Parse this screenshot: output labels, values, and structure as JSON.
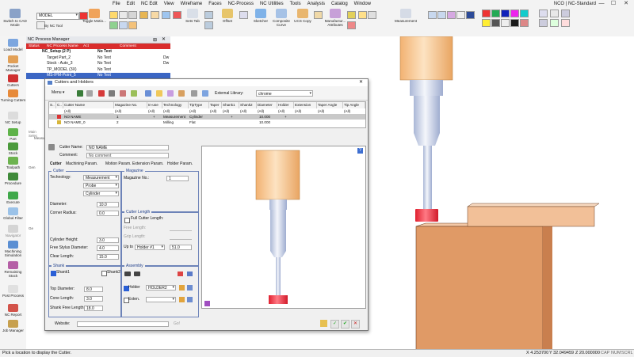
{
  "window": {
    "title": "NCO | NC-Standard",
    "minimize": "—",
    "maximize": "☐",
    "close": "✕"
  },
  "menu": [
    "File",
    "Edit",
    "NC Edit",
    "View",
    "Wireframe",
    "Faces",
    "NC-Process",
    "NC Utilities",
    "Tools",
    "Analysis",
    "Catalog",
    "Window"
  ],
  "ribbon": {
    "switch_cad": "Switch to CAD Mode",
    "model_select": "MODEL",
    "by_nc_tool": "By NC Tool",
    "toggle_motion": "Toggle Motio...",
    "sets_tab": "Sets Tab",
    "offset": "Offset",
    "sketcher": "Sketcher",
    "composite_curve": "Composite Curve",
    "ucs_copy": "UCS Copy",
    "manufacturing_attributes": "Manufactur... Attributes",
    "measurement": "Measurement"
  },
  "left_tools": [
    "Load Model",
    "Pocket Manager",
    "Cutters",
    "Turning Cutters",
    "NC Setup",
    "Part",
    "Stock",
    "Toolpath",
    "Procedure",
    "Execute",
    "Global Filter",
    "Navigator",
    "Machining Simulation",
    "Remaining Stock",
    "Post Process",
    "NC Report",
    "Job Manager"
  ],
  "process_manager": {
    "title": "NC Process Manager",
    "headers": [
      "Status",
      "NC Process Name",
      "Act",
      "Comment"
    ],
    "rows": [
      {
        "name": "NC_Setup (2 P)",
        "act": "",
        "comment": "No Text",
        "extra": ""
      },
      {
        "name": "Target Part_2",
        "act": "",
        "comment": "No Text",
        "extra": "Dw"
      },
      {
        "name": "Stock - Auto_3",
        "act": "",
        "comment": "No Text",
        "extra": "Dw"
      },
      {
        "name": "TP_MODEL (3X)",
        "act": "",
        "comment": "No Text",
        "extra": ""
      },
      {
        "name": "MS-IPM-Point_5",
        "act": "",
        "comment": "No Text",
        "extra": ""
      }
    ],
    "sub_items": [
      "Main Selec",
      "Measu",
      "Gen",
      "Ge"
    ]
  },
  "dialog": {
    "title": "Cutters and Holders",
    "menu_label": "Menu",
    "external_library_label": "External Library:",
    "external_library_value": "chrome",
    "grid_headers": [
      "S..",
      "C..",
      "Cutter Name",
      "Magazine No.",
      "In-use",
      "Technology",
      "TipType",
      "Taper",
      "Shank1",
      "Shank2",
      "Diameter",
      "Holder",
      "Extension",
      "Taper Angle",
      "Tip Angle"
    ],
    "grid_filters": [
      "",
      "",
      "(All)",
      "(All)",
      "(All)",
      "(All)",
      "(All)",
      "(All)",
      "(All)",
      "(All)",
      "(All)",
      "(All)",
      "(All)",
      "(All)",
      "(All)"
    ],
    "grid_rows": [
      {
        "name": "NO NAME",
        "magazine": "1",
        "in_use": "+",
        "technology": "Measurement",
        "tip": "Cylinder",
        "shank1": "+",
        "diameter": "10.000",
        "holder": "+"
      },
      {
        "name": "NO NAME_0",
        "magazine": "2",
        "in_use": "",
        "technology": "Milling",
        "tip": "Flat",
        "shank1": "",
        "diameter": "10.000",
        "holder": ""
      }
    ],
    "cutter_name_label": "Cutter Name:",
    "cutter_name_value": "NO NAME",
    "comment_label": "Comment:",
    "comment_value": "No comment",
    "tabs": [
      "Cutter",
      "Machining Param.",
      "Motion Param.",
      "Extension Param.",
      "Holder Param."
    ],
    "cutter_group": {
      "title": "Cutter",
      "technology_label": "Technology:",
      "technology": "Measurement",
      "subtype": "Probe",
      "tip": "Cylinder",
      "diameter_label": "Diameter:",
      "diameter": "10.0",
      "corner_radius_label": "Corner Radius:",
      "corner_radius": "0.0",
      "cylinder_height_label": "Cylinder Height:",
      "cylinder_height": "3.0",
      "free_stylus_label": "Free Stylus Diameter:",
      "free_stylus": "4.0",
      "clear_length_label": "Clear Length:",
      "clear_length": "15.0"
    },
    "magazine_group": {
      "title": "Magazine",
      "label": "Magazine No.:",
      "value": "1"
    },
    "cutter_length_group": {
      "title": "Cutter Length",
      "full_length_label": "Full Cutter Length:",
      "free_length_label": "Free Length:",
      "grip_length_label": "Grip Length:",
      "up_to_label": "Up to",
      "up_to_value": "Holder #1",
      "up_to_number": "51.0"
    },
    "shank_group": {
      "title": "Shank",
      "shank1": "Shank1",
      "shank2": "Shank2",
      "top_diameter_label": "Top Diameter:",
      "top_diameter": "8.0",
      "cone_length_label": "Cone Length:",
      "cone_length": "3.0",
      "shank_free_length_label": "Shank Free Length:",
      "shank_free_length": "18.0"
    },
    "assembly_group": {
      "title": "Assembly",
      "holder_label": "Holder",
      "holder_value": "HOLDER2",
      "exten_label": "Exten."
    },
    "website_label": "Website:",
    "go_label": "Go!"
  },
  "status": {
    "prompt": "Pick a location to display the Cutter.",
    "x": "X 4.253700",
    "y": "Y 32.049459",
    "z": "Z 20.000000",
    "flags": [
      "CAP",
      "NUM",
      "SCRL"
    ]
  },
  "colors": {
    "accent_red": "#d92d2d",
    "holder_orange": "#f5c28a",
    "shank_blue": "#c9d4ec",
    "tip_red": "#e8233a",
    "block_wood": "#e09a66",
    "group_border": "#6d83b8"
  }
}
